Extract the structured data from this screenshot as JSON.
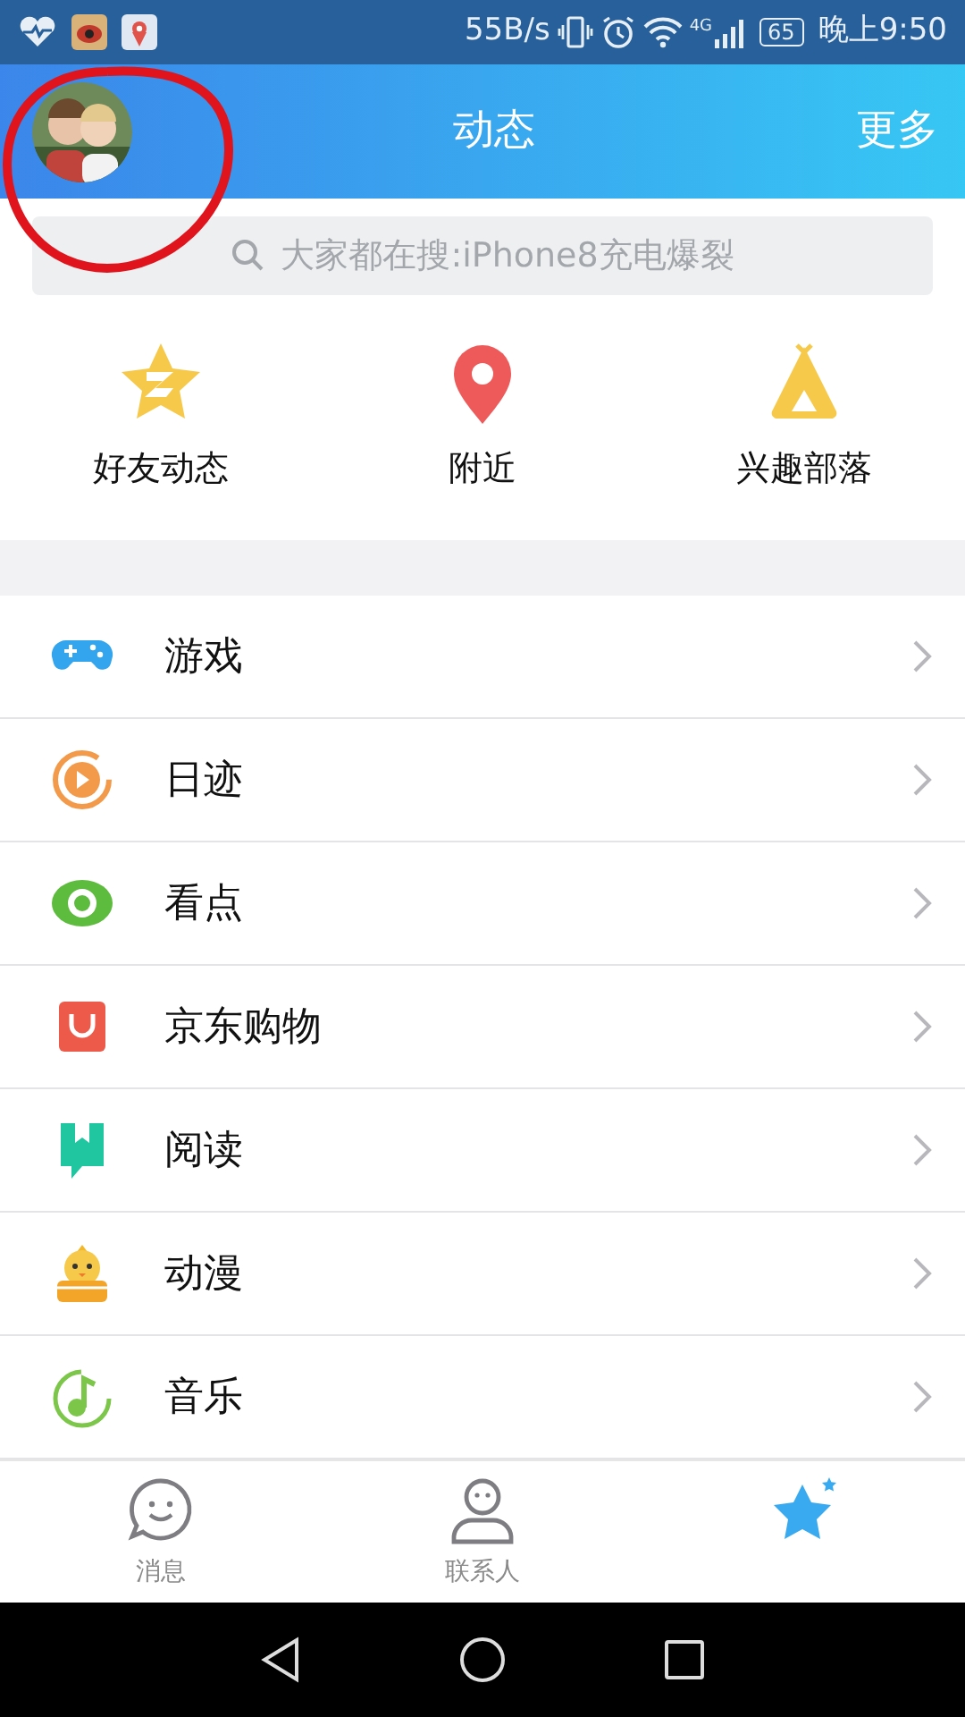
{
  "status_bar": {
    "speed": "55B/s",
    "network": "4G",
    "battery": "65",
    "time": "晚上9:50"
  },
  "header": {
    "title": "动态",
    "more": "更多"
  },
  "search": {
    "placeholder": "大家都在搜:iPhone8充电爆裂"
  },
  "shortcuts": [
    {
      "label": "好友动态"
    },
    {
      "label": "附近"
    },
    {
      "label": "兴趣部落"
    }
  ],
  "menu": [
    {
      "label": "游戏"
    },
    {
      "label": "日迹"
    },
    {
      "label": "看点"
    },
    {
      "label": "京东购物"
    },
    {
      "label": "阅读"
    },
    {
      "label": "动漫"
    },
    {
      "label": "音乐"
    }
  ],
  "tabs": [
    {
      "label": "消息",
      "selected": false
    },
    {
      "label": "联系人",
      "selected": false
    },
    {
      "selected": true
    }
  ]
}
